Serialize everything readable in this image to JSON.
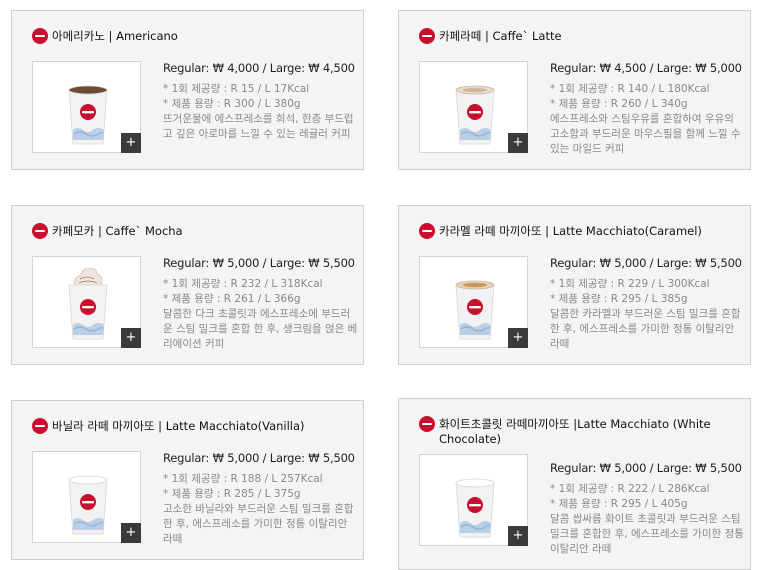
{
  "products": [
    {
      "title": "아메리카노 | Americano",
      "price": "Regular: ₩ 4,000 / Large: ₩ 4,500",
      "kcal": "* 1회 제공량 : R 15 / L 17Kcal",
      "volume": "* 제품 용량 : R 300 / L 380g",
      "desc": "뜨거운물에 에스프레소를 희석, 한층 부드럽고 깊은 아로마를 느낄 수 있는 레귤러 커피",
      "topping": "none",
      "zoom_label": "+"
    },
    {
      "title": "카페라떼 | Caffe` Latte",
      "price": "Regular: ₩ 4,500 / Large: ₩ 5,000",
      "kcal": "* 1회 제공량 : R 140 / L 180Kcal",
      "volume": "* 제품 용량 : R 260 / L 340g",
      "desc": "에스프레소와 스팀우유를 혼합하여 우유의 고소함과 부드러운 마우스필을 함께 느낄 수 있는 마일드 커피",
      "topping": "foam",
      "zoom_label": "+"
    },
    {
      "title": "카페모카 | Caffe` Mocha",
      "price": "Regular: ₩ 5,000 / Large: ₩ 5,500",
      "kcal": "* 1회 제공량 : R 232 / L 318Kcal",
      "volume": "* 제품 용량 : R 261 / L 366g",
      "desc": "달콤한 다크 초콜릿과 에스프레소에 부드러운 스팀 밀크를 혼합 한 후, 생크림을 얹은 베리에이션 커피",
      "topping": "whip",
      "zoom_label": "+"
    },
    {
      "title": "카라멜 라떼 마끼아또 | Latte Macchiato(Caramel)",
      "price": "Regular: ₩ 5,000 / Large: ₩ 5,500",
      "kcal": "* 1회 제공량 : R 229 / L 300Kcal",
      "volume": "* 제품 용량 : R 295 / L 385g",
      "desc": "달콤한 카라멜과 부드러운 스팀 밀크를 혼합 한 후, 에스프레소를 가미한 정통 이탈리안 라떼",
      "topping": "caramel",
      "zoom_label": "+"
    },
    {
      "title": "바닐라 라떼 마끼아또 | Latte Macchiato(Vanilla)",
      "price": "Regular: ₩ 5,000 / Large: ₩ 5,500",
      "kcal": "* 1회 제공량 : R 188 / L 257Kcal",
      "volume": "* 제품 용량 : R 285 / L 375g",
      "desc": "고소한 바닐라와 부드러운 스팀 밀크를 혼합 한 후, 에스프레소를 가미한 정통 이탈리안 라떼",
      "topping": "plain",
      "zoom_label": "+"
    },
    {
      "title": "화이트초콜릿 라떼마끼아또 |Latte Macchiato (White Chocolate)",
      "price": "Regular: ₩ 5,000 / Large: ₩ 5,500",
      "kcal": "* 1회 제공량 : R 222 / L 286Kcal",
      "volume": "* 제품 용량 : R 295 / L 405g",
      "desc": "달콤 쌉싸름 화이트 초콜릿과 부드러운 스팀 밀크를 혼합한 후, 에스프레소를 가미한 정통 이탈리안 라떼",
      "topping": "plain",
      "zoom_label": "+"
    }
  ],
  "colors": {
    "brand": "#c8102e",
    "card_bg": "#f4f4f4",
    "muted_text": "#888888"
  }
}
